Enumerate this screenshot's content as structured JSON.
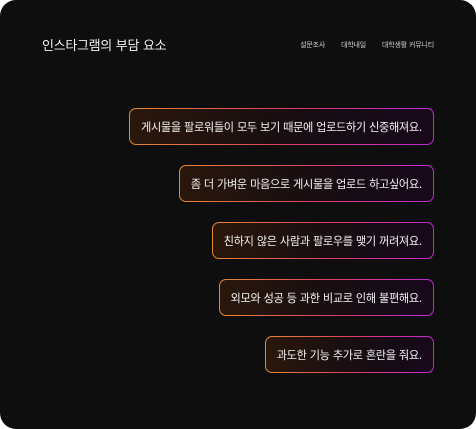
{
  "header": {
    "title": "인스타그램의 부담 요소",
    "nav": [
      "설문조사",
      "대학내일",
      "대학생활 커뮤니티"
    ]
  },
  "statements": [
    "게시물을 팔로워들이 모두 보기 때문에 업로드하기 신중해져요.",
    "좀 더 가벼운 마음으로 게시물을 업로드 하고싶어요.",
    "친하지 않은 사람과 팔로우를 맺기 꺼려져요.",
    "외모와 성공 등 과한 비교로 인해 불편해요.",
    "과도한 기능 추가로 혼란을 줘요."
  ],
  "colors": {
    "background": "#0e0e0e",
    "border_gradient": [
      "#e38a2e",
      "#e0376c",
      "#c02ad6"
    ],
    "text": "#f3f3f3"
  }
}
